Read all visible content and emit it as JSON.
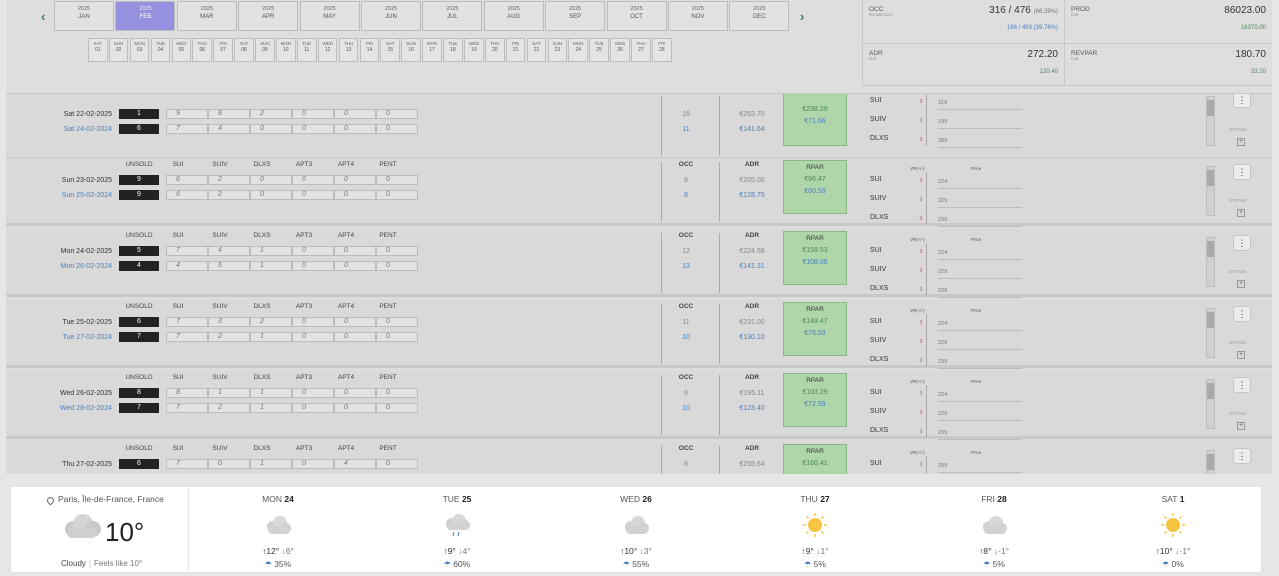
{
  "nav": {
    "prev": "‹",
    "next": "›"
  },
  "months": [
    {
      "year": "2025",
      "name": "JAN",
      "selected": false
    },
    {
      "year": "2025",
      "name": "FEB",
      "selected": true
    },
    {
      "year": "2025",
      "name": "MAR",
      "selected": false
    },
    {
      "year": "2025",
      "name": "APR",
      "selected": false
    },
    {
      "year": "2025",
      "name": "MAY",
      "selected": false
    },
    {
      "year": "2025",
      "name": "JUN",
      "selected": false
    },
    {
      "year": "2025",
      "name": "JUL",
      "selected": false
    },
    {
      "year": "2025",
      "name": "AUG",
      "selected": false
    },
    {
      "year": "2025",
      "name": "SEP",
      "selected": false
    },
    {
      "year": "2025",
      "name": "OCT",
      "selected": false
    },
    {
      "year": "2025",
      "name": "NOV",
      "selected": false
    },
    {
      "year": "2025",
      "name": "DEC",
      "selected": false
    }
  ],
  "days": [
    {
      "dow": "SAT",
      "num": "01"
    },
    {
      "dow": "SUN",
      "num": "02"
    },
    {
      "dow": "MON",
      "num": "03"
    },
    {
      "dow": "TUE",
      "num": "04"
    },
    {
      "dow": "WED",
      "num": "05"
    },
    {
      "dow": "THU",
      "num": "06"
    },
    {
      "dow": "FRI",
      "num": "07"
    },
    {
      "dow": "SAT",
      "num": "08"
    },
    {
      "dow": "SUN",
      "num": "09"
    },
    {
      "dow": "MON",
      "num": "10"
    },
    {
      "dow": "TUE",
      "num": "11"
    },
    {
      "dow": "WED",
      "num": "12"
    },
    {
      "dow": "THU",
      "num": "13"
    },
    {
      "dow": "FRI",
      "num": "14"
    },
    {
      "dow": "SAT",
      "num": "15"
    },
    {
      "dow": "SUN",
      "num": "16"
    },
    {
      "dow": "MON",
      "num": "17"
    },
    {
      "dow": "TUE",
      "num": "18"
    },
    {
      "dow": "WED",
      "num": "19"
    },
    {
      "dow": "THU",
      "num": "20"
    },
    {
      "dow": "FRI",
      "num": "21"
    },
    {
      "dow": "SAT",
      "num": "22"
    },
    {
      "dow": "SUN",
      "num": "23"
    },
    {
      "dow": "MON",
      "num": "24"
    },
    {
      "dow": "TUE",
      "num": "25"
    },
    {
      "dow": "WED",
      "num": "26"
    },
    {
      "dow": "THU",
      "num": "27"
    },
    {
      "dow": "FRI",
      "num": "28"
    }
  ],
  "kpis": {
    "occ": {
      "label": "OCC",
      "sub": "ROOMS SOLD",
      "value": "316 / 476",
      "pct": "(66.39%)",
      "compare": "196 / 493 (39.76%)"
    },
    "prod": {
      "label": "PROD",
      "sub": "EUR",
      "value": "86023.00",
      "compare": "16370.00"
    },
    "adr": {
      "label": "ADR",
      "sub": "EUR",
      "value": "272.20",
      "compare": "120.40"
    },
    "revpar": {
      "label": "REVPAR",
      "sub": "EUR",
      "value": "180.70",
      "compare": "33.20"
    }
  },
  "columns": {
    "unsold": "UNSOLD",
    "sui": "SUI",
    "suiv": "SUIV",
    "dlxs": "DLXS",
    "apt3": "APT3",
    "apt4": "APT4",
    "pent": "PENT",
    "occ": "OCC",
    "adr": "ADR",
    "rpar": "RPAR",
    "vr": "VR(+/-)",
    "price": "Price",
    "status": "STATUS"
  },
  "room_types": [
    "SUI",
    "SUIV",
    "DLXS"
  ],
  "rows": [
    {
      "date": "Sat 22-02-2025",
      "cmp_date": "Sat 24-02-2024",
      "unsold": [
        "1",
        "6"
      ],
      "sui": [
        "9",
        "7"
      ],
      "suiv": [
        "8",
        "4"
      ],
      "dlxs": [
        "2",
        "0"
      ],
      "apt3": [
        "0",
        "0"
      ],
      "apt4": [
        "0",
        "0"
      ],
      "pent": [
        "0",
        "0"
      ],
      "occ": [
        "16",
        "11"
      ],
      "adr": [
        "€253.70",
        "€141.64"
      ],
      "rpar": [
        "€238.29",
        "€71.66"
      ],
      "vr": [
        "0",
        "0",
        "0"
      ],
      "prices": [
        "219",
        "199",
        "289"
      ]
    },
    {
      "date": "Sun 23-02-2025",
      "cmp_date": "Sun 25-02-2024",
      "unsold": [
        "9",
        "9"
      ],
      "sui": [
        "6",
        "6"
      ],
      "suiv": [
        "2",
        "2"
      ],
      "dlxs": [
        "0",
        "0"
      ],
      "apt3": [
        "0",
        "0"
      ],
      "apt4": [
        "0",
        "0"
      ],
      "pent": [
        "0",
        "0"
      ],
      "occ": [
        "8",
        "8"
      ],
      "adr": [
        "€205.00",
        "€128.75"
      ],
      "rpar": [
        "€96.47",
        "€60.59"
      ],
      "vr": [
        "0",
        "0",
        "0"
      ],
      "prices": [
        "224",
        "229",
        "239"
      ]
    },
    {
      "date": "Mon 24-02-2025",
      "cmp_date": "Mon 26-02-2024",
      "unsold": [
        "5",
        "4"
      ],
      "sui": [
        "7",
        "4"
      ],
      "suiv": [
        "4",
        "5"
      ],
      "dlxs": [
        "1",
        "1"
      ],
      "apt3": [
        "0",
        "0"
      ],
      "apt4": [
        "0",
        "0"
      ],
      "pent": [
        "0",
        "0"
      ],
      "occ": [
        "12",
        "13"
      ],
      "adr": [
        "€224.58",
        "€141.31"
      ],
      "rpar": [
        "€158.53",
        "€108.06"
      ],
      "vr": [
        "0",
        "0",
        "0"
      ],
      "prices": [
        "224",
        "229",
        "239"
      ]
    },
    {
      "date": "Tue 25-02-2025",
      "cmp_date": "Tue 27-02-2024",
      "unsold": [
        "6",
        "7"
      ],
      "sui": [
        "7",
        "7"
      ],
      "suiv": [
        "3",
        "2"
      ],
      "dlxs": [
        "2",
        "1"
      ],
      "apt3": [
        "0",
        "0"
      ],
      "apt4": [
        "0",
        "0"
      ],
      "pent": [
        "0",
        "0"
      ],
      "occ": [
        "11",
        "10"
      ],
      "adr": [
        "€231.00",
        "€130.10"
      ],
      "rpar": [
        "€149.47",
        "€76.53"
      ],
      "vr": [
        "0",
        "0",
        "0"
      ],
      "prices": [
        "224",
        "229",
        "239"
      ]
    },
    {
      "date": "Wed 26-02-2025",
      "cmp_date": "Wed 28-02-2024",
      "unsold": [
        "8",
        "7"
      ],
      "sui": [
        "8",
        "7"
      ],
      "suiv": [
        "1",
        "2"
      ],
      "dlxs": [
        "1",
        "1"
      ],
      "apt3": [
        "0",
        "0"
      ],
      "apt4": [
        "0",
        "0"
      ],
      "pent": [
        "0",
        "0"
      ],
      "occ": [
        "9",
        "10"
      ],
      "adr": [
        "€195.11",
        "€123.40"
      ],
      "rpar": [
        "€103.29",
        "€72.59"
      ],
      "vr": [
        "0",
        "0",
        "0"
      ],
      "prices": [
        "224",
        "229",
        "239"
      ]
    },
    {
      "date": "Thu 27-02-2025",
      "cmp_date": "",
      "unsold": [
        "6",
        ""
      ],
      "sui": [
        "7",
        ""
      ],
      "suiv": [
        "0",
        ""
      ],
      "dlxs": [
        "1",
        ""
      ],
      "apt3": [
        "0",
        ""
      ],
      "apt4": [
        "4",
        ""
      ],
      "pent": [
        "0",
        ""
      ],
      "occ": [
        "8",
        ""
      ],
      "adr": [
        "€255.64",
        ""
      ],
      "rpar": [
        "€166.41",
        ""
      ],
      "vr": [
        "0",
        "",
        ""
      ],
      "prices": [
        "299",
        "",
        ""
      ]
    }
  ],
  "weather": {
    "location": "Paris, Île-de-France, France",
    "temp": "10°",
    "condition": "Cloudy",
    "divider": "|",
    "feels": "Feels like 10°",
    "forecast": [
      {
        "dow": "MON",
        "day": "24",
        "icon": "cloud",
        "hi": "12°",
        "lo": "6°",
        "precip": "35%"
      },
      {
        "dow": "TUE",
        "day": "25",
        "icon": "rain",
        "hi": "9°",
        "lo": "4°",
        "precip": "60%"
      },
      {
        "dow": "WED",
        "day": "26",
        "icon": "cloud",
        "hi": "10°",
        "lo": "3°",
        "precip": "55%"
      },
      {
        "dow": "THU",
        "day": "27",
        "icon": "sun",
        "hi": "9°",
        "lo": "1°",
        "precip": "5%"
      },
      {
        "dow": "FRI",
        "day": "28",
        "icon": "cloud",
        "hi": "8°",
        "lo": "-1°",
        "precip": "5%"
      },
      {
        "dow": "SAT",
        "day": "1",
        "icon": "sun",
        "hi": "10°",
        "lo": "-1°",
        "precip": "0%"
      }
    ]
  }
}
